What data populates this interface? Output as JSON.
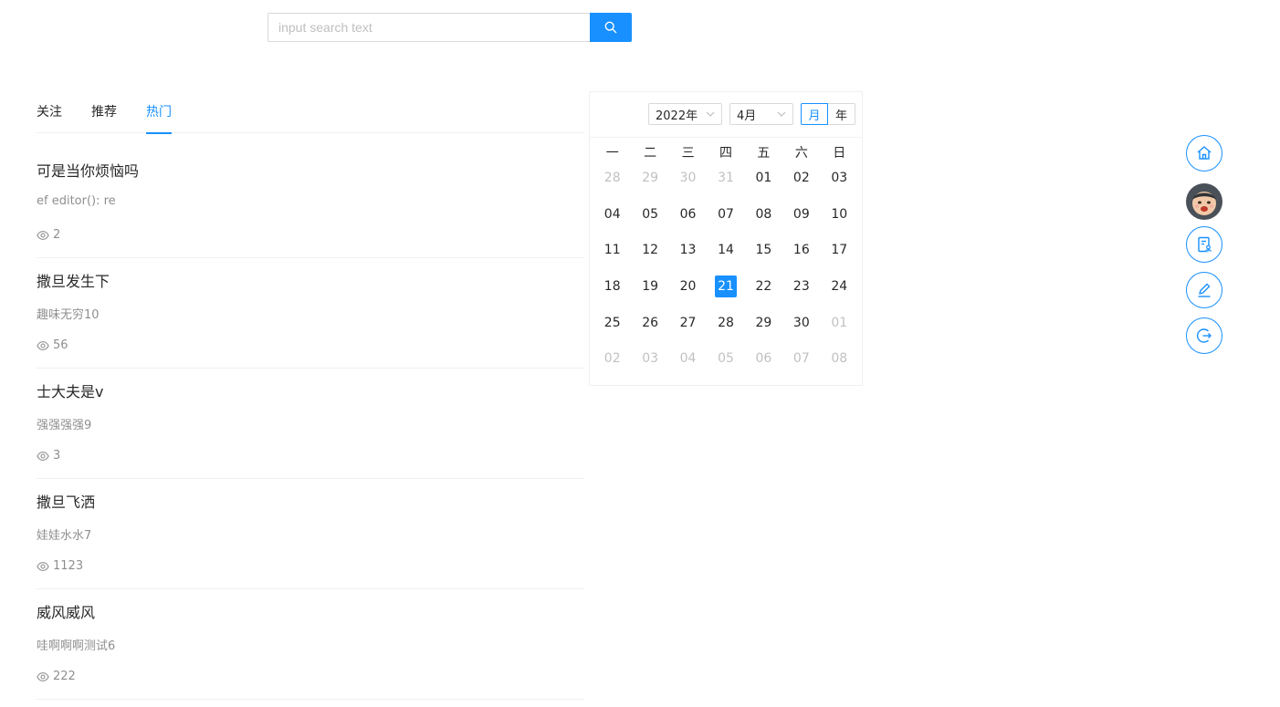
{
  "search": {
    "placeholder": "input search text",
    "icon": "search-icon",
    "accent": "#1890ff"
  },
  "tabs": [
    {
      "label": "关注",
      "active": false
    },
    {
      "label": "推荐",
      "active": false
    },
    {
      "label": "热门",
      "active": true
    }
  ],
  "articles": [
    {
      "title": "可是当你烦恼吗",
      "summary": "ef editor(): re",
      "views": "2"
    },
    {
      "title": "撒旦发生下",
      "summary": "趣味无穷10",
      "views": "56"
    },
    {
      "title": "士大夫是v",
      "summary": "强强强强9",
      "views": "3"
    },
    {
      "title": "撒旦飞洒",
      "summary": "娃娃水水7",
      "views": "1123"
    },
    {
      "title": "威风威风",
      "summary": "哇啊啊啊测试6",
      "views": "222"
    }
  ],
  "calendar": {
    "year_select": "2022年",
    "month_select": "4月",
    "mode_month": "月",
    "mode_year": "年",
    "active_mode": "month",
    "weekdays": [
      "一",
      "二",
      "三",
      "四",
      "五",
      "六",
      "日"
    ],
    "weeks": [
      [
        {
          "d": "28",
          "out": true
        },
        {
          "d": "29",
          "out": true
        },
        {
          "d": "30",
          "out": true
        },
        {
          "d": "31",
          "out": true
        },
        {
          "d": "01"
        },
        {
          "d": "02"
        },
        {
          "d": "03"
        }
      ],
      [
        {
          "d": "04"
        },
        {
          "d": "05"
        },
        {
          "d": "06"
        },
        {
          "d": "07"
        },
        {
          "d": "08"
        },
        {
          "d": "09"
        },
        {
          "d": "10"
        }
      ],
      [
        {
          "d": "11"
        },
        {
          "d": "12"
        },
        {
          "d": "13"
        },
        {
          "d": "14"
        },
        {
          "d": "15"
        },
        {
          "d": "16"
        },
        {
          "d": "17"
        }
      ],
      [
        {
          "d": "18"
        },
        {
          "d": "19"
        },
        {
          "d": "20"
        },
        {
          "d": "21",
          "selected": true
        },
        {
          "d": "22"
        },
        {
          "d": "23"
        },
        {
          "d": "24"
        }
      ],
      [
        {
          "d": "25"
        },
        {
          "d": "26"
        },
        {
          "d": "27"
        },
        {
          "d": "28"
        },
        {
          "d": "29"
        },
        {
          "d": "30"
        },
        {
          "d": "01",
          "out": true
        }
      ],
      [
        {
          "d": "02",
          "out": true
        },
        {
          "d": "03",
          "out": true
        },
        {
          "d": "04",
          "out": true
        },
        {
          "d": "05",
          "out": true
        },
        {
          "d": "06",
          "out": true
        },
        {
          "d": "07",
          "out": true
        },
        {
          "d": "08",
          "out": true
        }
      ]
    ]
  },
  "side_nav": [
    {
      "icon": "home-icon"
    },
    {
      "icon": "avatar"
    },
    {
      "icon": "document-user-icon"
    },
    {
      "icon": "edit-icon"
    },
    {
      "icon": "logout-icon"
    }
  ]
}
